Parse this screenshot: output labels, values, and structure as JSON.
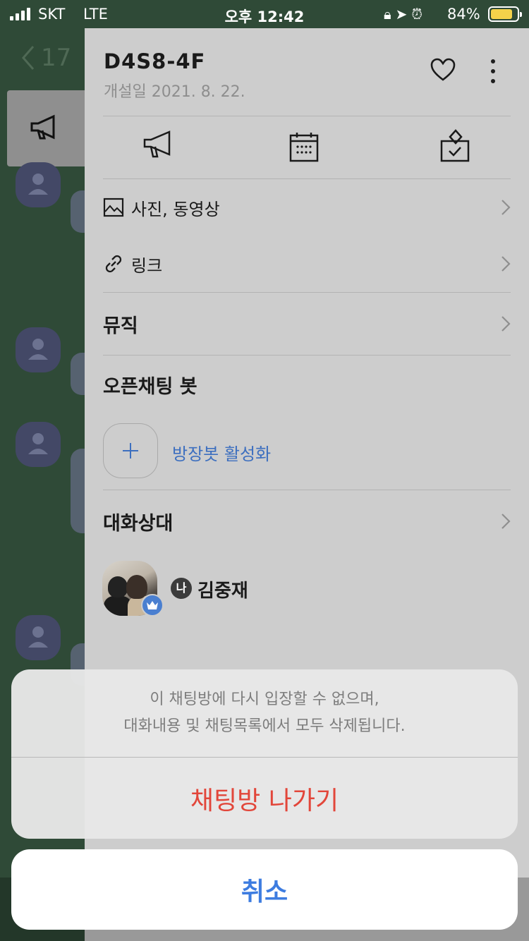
{
  "status_bar": {
    "carrier": "SKT",
    "network": "LTE",
    "time": "오후 12:42",
    "battery_percent": "84%",
    "battery_level": 0.84,
    "battery_color": "#f4d24a"
  },
  "background_chat": {
    "back_count": "17",
    "back_icon": "chevron-left-icon",
    "notice_icon": "megaphone-icon",
    "avatar_icon": "person-icon"
  },
  "drawer": {
    "room_title": "D4S8-4F",
    "created_label": "개설일 2021. 8. 22.",
    "icons": {
      "favorite": "heart-icon",
      "more": "more-vertical-icon",
      "notice": "megaphone-icon",
      "calendar": "calendar-icon",
      "vote": "vote-box-icon"
    },
    "media_rows": [
      {
        "label": "사진, 동영상",
        "icon": "photo-icon"
      },
      {
        "label": "링크",
        "icon": "link-icon"
      }
    ],
    "music_label": "뮤직",
    "bot_section_title": "오픈채팅 봇",
    "bot_action_label": "방장봇 활성화",
    "members_section_title": "대화상대",
    "members": [
      {
        "me_badge": "나",
        "name": "김중재"
      }
    ]
  },
  "action_sheet": {
    "message_line1": "이 채팅방에 다시 입장할 수 없으며,",
    "message_line2": "대화내용 및 채팅목록에서 모두 삭제됩니다.",
    "leave_label": "채팅방 나가기",
    "cancel_label": "취소",
    "leave_color": "#e2463a",
    "cancel_color": "#3d7ce0"
  }
}
